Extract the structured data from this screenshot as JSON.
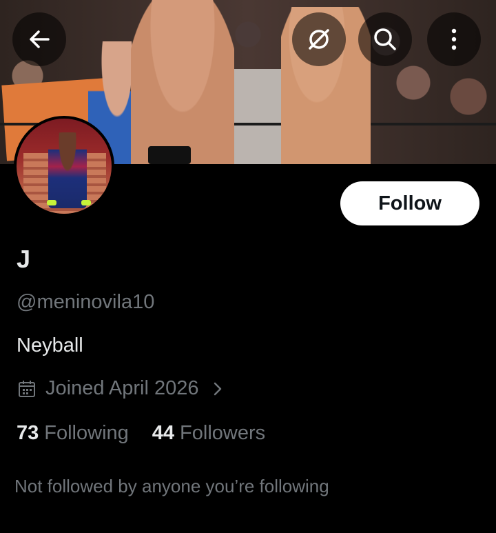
{
  "header": {
    "back_icon": "back-arrow-icon",
    "grok_icon": "grok-icon",
    "search_icon": "search-icon",
    "more_icon": "more-vertical-icon"
  },
  "profile": {
    "follow_label": "Follow",
    "display_name": "J",
    "handle": "@meninovila10",
    "bio": "Neyball",
    "joined": "Joined April 2026",
    "following_count": "73",
    "following_label": "Following",
    "followers_count": "44",
    "followers_label": "Followers",
    "not_followed_text": "Not followed by anyone you’re following"
  },
  "colors": {
    "background": "#000000",
    "primary_text": "#e7e9ea",
    "secondary_text": "#71767b",
    "follow_button_bg": "#ffffff"
  }
}
